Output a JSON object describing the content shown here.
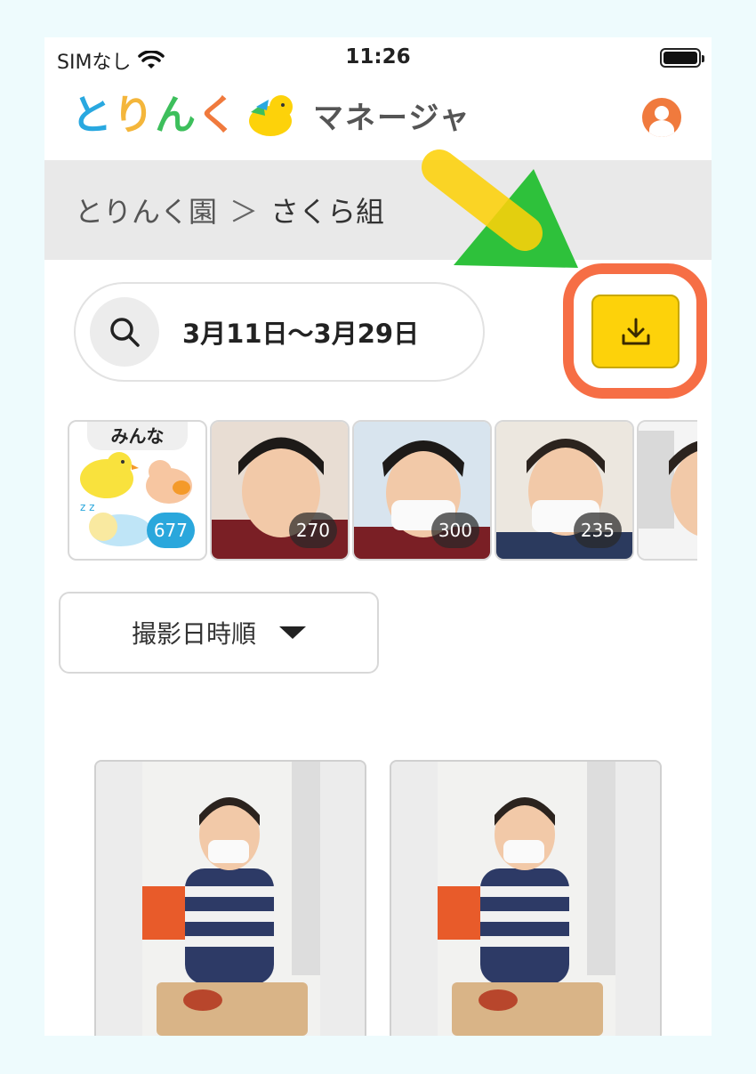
{
  "status_bar": {
    "carrier": "SIMなし",
    "time": "11:26"
  },
  "header": {
    "logo_letters": [
      {
        "char": "と",
        "color": "#29a8e0"
      },
      {
        "char": "り",
        "color": "#f4b63b"
      },
      {
        "char": "ん",
        "color": "#3dbf5c"
      },
      {
        "char": "く",
        "color": "#f07a3d"
      }
    ],
    "app_subtitle": "マネージャ"
  },
  "breadcrumb": {
    "school": "とりんく園",
    "separator": "＞",
    "class": "さくら組"
  },
  "search": {
    "date_range": "3月11日〜3月29日"
  },
  "children_strip": {
    "all_card": {
      "label": "みんな",
      "count": "677"
    },
    "children": [
      {
        "count": "270"
      },
      {
        "count": "300"
      },
      {
        "count": "235"
      },
      {
        "count": ""
      }
    ]
  },
  "sort": {
    "label": "撮影日時順"
  },
  "colors": {
    "accent_yellow": "#fdd20a",
    "highlight_orange": "#f66e45",
    "badge_blue": "#2aa7dc"
  }
}
